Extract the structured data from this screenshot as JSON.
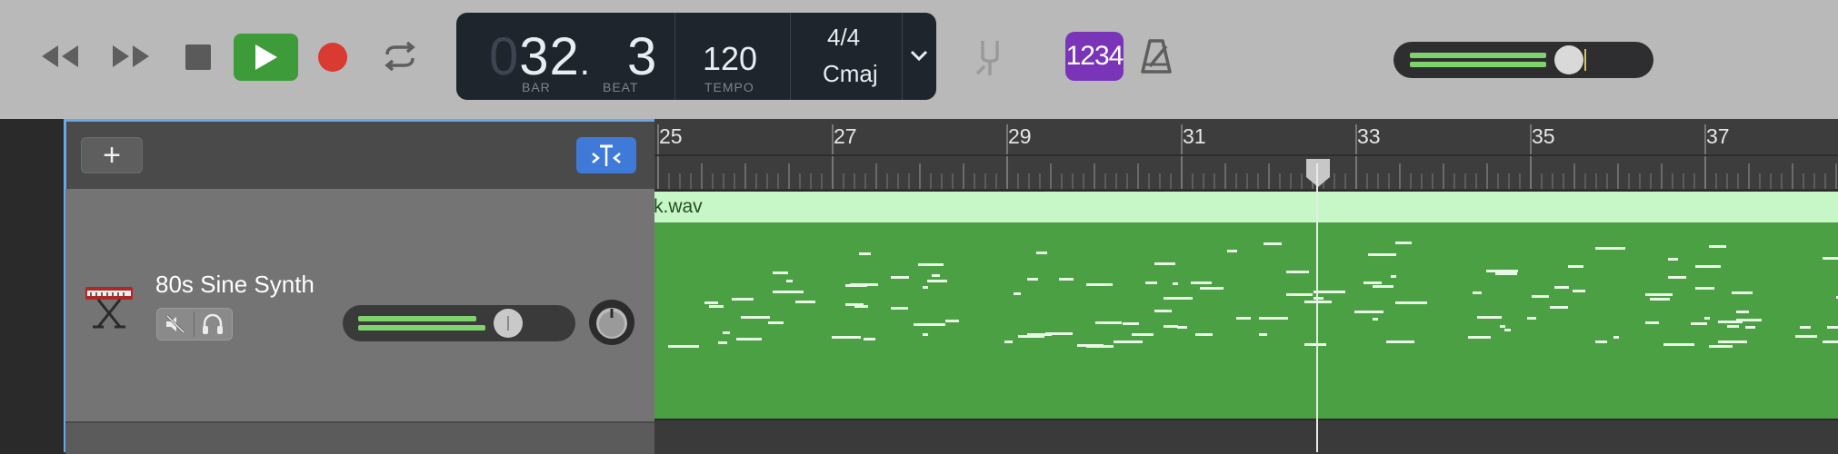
{
  "transport": {
    "rewind_icon": "rewind-icon",
    "forward_icon": "fast-forward-icon",
    "stop_icon": "stop-icon",
    "play_icon": "play-icon",
    "record_icon": "record-icon",
    "cycle_icon": "cycle-icon",
    "play_color": "#3e9b3a",
    "record_color": "#d93a31"
  },
  "lcd": {
    "bar_ghost": "0",
    "bar": "32",
    "dot": ".",
    "beat": "3",
    "bar_label": "BAR",
    "beat_label": "BEAT",
    "tempo": "120",
    "tempo_label": "TEMPO",
    "time_signature": "4/4",
    "key": "Cmaj"
  },
  "toolbar": {
    "tuner_icon": "tuning-fork-icon",
    "count_in": "1234",
    "count_in_color": "#7a34b8",
    "metronome_icon": "metronome-icon",
    "master_volume_level": 0.68
  },
  "track_header": {
    "add_label": "+",
    "smart_controls_icon": "smart-controls-icon",
    "smart_color": "#3f7ad8"
  },
  "track": {
    "name": "80s Sine Synth",
    "instrument_icon": "keyboard-synth-icon",
    "mute_icon": "mute-icon",
    "solo_icon": "headphones-icon",
    "volume_level": 0.72
  },
  "ruler": {
    "bars": [
      "25",
      "27",
      "29",
      "31",
      "33",
      "35",
      "37"
    ],
    "playhead_position": "32.3"
  },
  "region": {
    "name": "k.wav",
    "color": "#4aa043",
    "band_color": "#c7f6c7"
  }
}
